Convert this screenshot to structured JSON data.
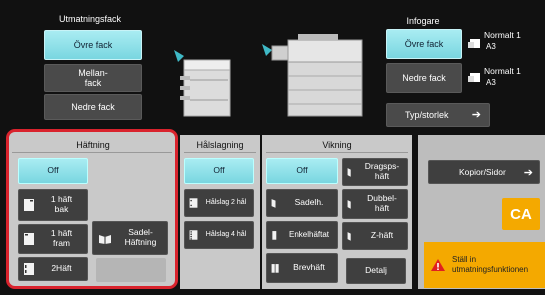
{
  "output_tray": {
    "title": "Utmatningsfack",
    "buttons": [
      "Övre fack",
      "Mellan-\nfack",
      "Nedre fack"
    ]
  },
  "inserter": {
    "title": "Infogare",
    "buttons": [
      "Övre fack",
      "Nedre fack"
    ],
    "paper": [
      {
        "type": "Normalt 1",
        "size": "A3"
      },
      {
        "type": "Normalt 1",
        "size": "A3"
      }
    ],
    "type_size_button": "Typ/storlek"
  },
  "stapling": {
    "title": "Häftning",
    "off": "Off",
    "one_back": "1 häft\nbak",
    "one_front": "1 häft\nfram",
    "two": "2Häft",
    "saddle": "Sadel-\nHäftning"
  },
  "punching": {
    "title": "Hålslagning",
    "off": "Off",
    "two": "Hålslag 2 hål",
    "four": "Hålslag 4 hål"
  },
  "folding": {
    "title": "Vikning",
    "off": "Off",
    "saddle": "Sadelh.",
    "single": "Enkelhäftat",
    "letter": "Brevhäft",
    "z_fold_pull": "Dragsps-\nhäft",
    "double": "Dubbel-\nhäft",
    "z": "Z-häft",
    "detail": "Detalj"
  },
  "right": {
    "copies_button": "Kopior/Sidor",
    "ca_label": "CA",
    "warning": "Ställ in\nutmatningsfunktionen"
  },
  "colors": {
    "highlight_border": "#d9232d",
    "accent_cyan": "#7fd8e2",
    "warning_bg": "#f4a900",
    "ca_bg": "#f4a900"
  }
}
